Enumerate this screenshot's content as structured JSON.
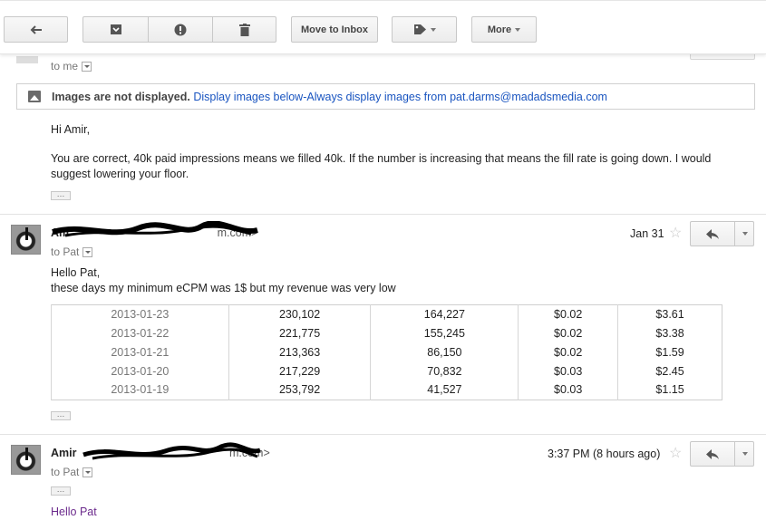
{
  "toolbar": {
    "move_to_inbox": "Move to Inbox",
    "more": "More",
    "icons": [
      "back-arrow-icon",
      "archive-icon",
      "report-spam-icon",
      "trash-icon",
      "label-tag-icon"
    ]
  },
  "message1": {
    "to": "to me",
    "images_notice": {
      "bold": "Images are not displayed.",
      "display_below": "Display images below",
      "separator": " - ",
      "always_display": "Always display images from pat.darms@madadsmedia.com"
    },
    "greeting": "Hi Amir,",
    "body": "You are correct, 40k paid impressions means we filled 40k.  If the number is increasing that means the fill rate is going down.  I would suggest lowering your floor.",
    "ellipsis": "…"
  },
  "message2": {
    "sender_name": "Am",
    "sender_email": "<a",
    "sender_email_tail": "m.com>",
    "to": "to Pat",
    "date": "Jan 31",
    "greeting": "Hello Pat,",
    "body": "these days my minimum eCPM was 1$ but my revenue was very low",
    "table": [
      [
        "2013-01-23",
        "230,102",
        "164,227",
        "$0.02",
        "$3.61"
      ],
      [
        "2013-01-22",
        "221,775",
        "155,245",
        "$0.02",
        "$3.38"
      ],
      [
        "2013-01-21",
        "213,363",
        "86,150",
        "$0.02",
        "$1.59"
      ],
      [
        "2013-01-20",
        "217,229",
        "70,832",
        "$0.03",
        "$2.45"
      ],
      [
        "2013-01-19",
        "253,792",
        "41,527",
        "$0.03",
        "$1.15"
      ]
    ],
    "ellipsis": "…"
  },
  "message3": {
    "sender_name": "Amir",
    "sender_email_tail": "m.com>",
    "to": "to Pat",
    "date": "3:37 PM (8 hours ago)",
    "greeting": "Hello Pat",
    "ellipsis": "…"
  },
  "colors": {
    "link": "#1a55c0",
    "accent_purple": "#6b2a8c"
  }
}
